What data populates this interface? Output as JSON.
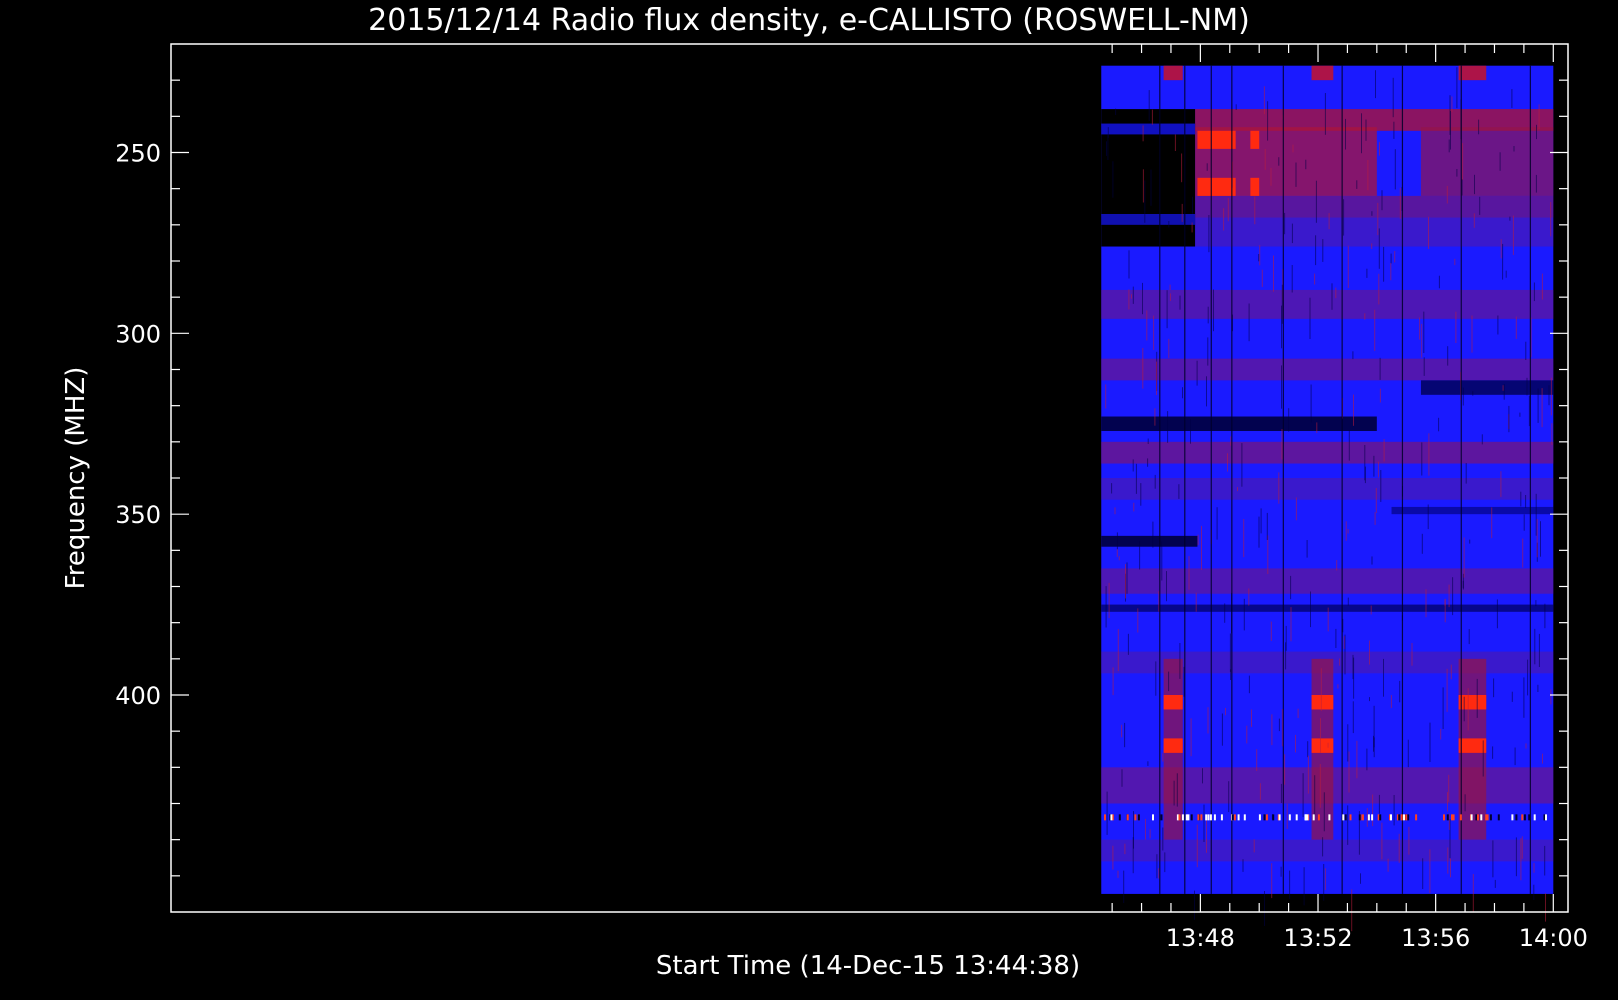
{
  "chart_data": {
    "type": "heatmap",
    "title": "2015/12/14  Radio flux density, e-CALLISTO (ROSWELL-NM)",
    "xlabel": "Start Time (14-Dec-15 13:44:38)",
    "ylabel": "Frequency (MHZ)",
    "x_start_minutes": 13.75,
    "xlim_minutes": [
      13.0,
      60.5
    ],
    "data_xlim_minutes": [
      44.63,
      60.0
    ],
    "ylim_mhz": [
      220,
      460
    ],
    "data_ylim_mhz": [
      226,
      455
    ],
    "y_inverted": true,
    "x_ticks": [
      {
        "minute": 48,
        "label": "13:48"
      },
      {
        "minute": 52,
        "label": "13:52"
      },
      {
        "minute": 56,
        "label": "13:56"
      },
      {
        "minute": 60,
        "label": "14:00"
      }
    ],
    "y_ticks": [
      {
        "mhz": 250,
        "label": "250"
      },
      {
        "mhz": 300,
        "label": "300"
      },
      {
        "mhz": 350,
        "label": "350"
      },
      {
        "mhz": 400,
        "label": "400"
      }
    ],
    "colors": {
      "background": "#000000",
      "low": "#1a1aff",
      "mid": "#8c1a6a",
      "high": "#ff2a10",
      "gap": "#000000",
      "text": "#ffffff"
    },
    "features": [
      {
        "name": "receiver-gap",
        "t0": 44.63,
        "t1": 47.82,
        "f0": 238,
        "f1": 276
      },
      {
        "name": "burst-250mhz",
        "t0": 47.9,
        "t1": 49.2,
        "f0": 244,
        "f1": 262,
        "level": "high"
      },
      {
        "name": "burst-250mhz-late",
        "t0": 49.7,
        "t1": 50.0,
        "f0": 244,
        "f1": 262,
        "level": "high"
      },
      {
        "name": "cal-block-1",
        "t0": 46.75,
        "t1": 47.4,
        "f0": 400,
        "f1": 418,
        "level": "high"
      },
      {
        "name": "cal-block-2",
        "t0": 51.78,
        "t1": 52.52,
        "f0": 400,
        "f1": 418,
        "level": "high"
      },
      {
        "name": "cal-block-3",
        "t0": 56.78,
        "t1": 57.72,
        "f0": 400,
        "f1": 418,
        "level": "high"
      }
    ]
  }
}
